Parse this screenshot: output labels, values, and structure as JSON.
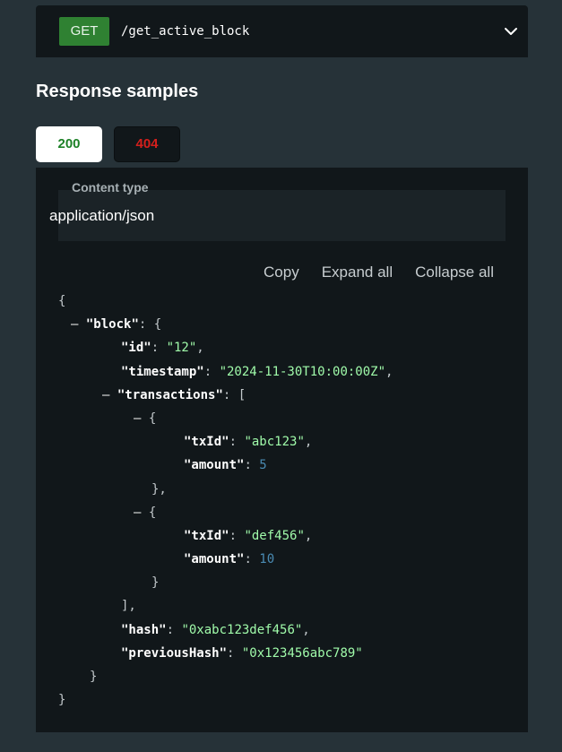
{
  "endpoint": {
    "method": "GET",
    "path": "/get_active_block",
    "expand_icon": "chevron-down-icon",
    "method_color": "#2f8132"
  },
  "response_samples": {
    "title": "Response samples",
    "tabs": [
      {
        "label": "200",
        "color": "#1d8127",
        "selected": true
      },
      {
        "label": "404",
        "color": "#d41f1c",
        "selected": false
      }
    ],
    "content_type_label": "Content type",
    "content_type_value": "application/json",
    "actions": {
      "copy": "Copy",
      "expand_all": "Expand all",
      "collapse_all": "Collapse all"
    },
    "json": {
      "open_brace": "{",
      "close_brace": "}",
      "toggle": "–",
      "block_key": "\"block\"",
      "id_key": "\"id\"",
      "id_value": "\"12\"",
      "timestamp_key": "\"timestamp\"",
      "timestamp_value": "\"2024-11-30T10:00:00Z\"",
      "transactions_key": "\"transactions\"",
      "open_bracket": "[",
      "close_bracket": "],",
      "tx1_txid_key": "\"txId\"",
      "tx1_txid_value": "\"abc123\"",
      "tx1_amount_key": "\"amount\"",
      "tx1_amount_value": "5",
      "tx2_txid_key": "\"txId\"",
      "tx2_txid_value": "\"def456\"",
      "tx2_amount_key": "\"amount\"",
      "tx2_amount_value": "10",
      "hash_key": "\"hash\"",
      "hash_value": "\"0xabc123def456\"",
      "prev_hash_key": "\"previousHash\"",
      "prev_hash_value": "\"0x123456abc789\""
    }
  }
}
